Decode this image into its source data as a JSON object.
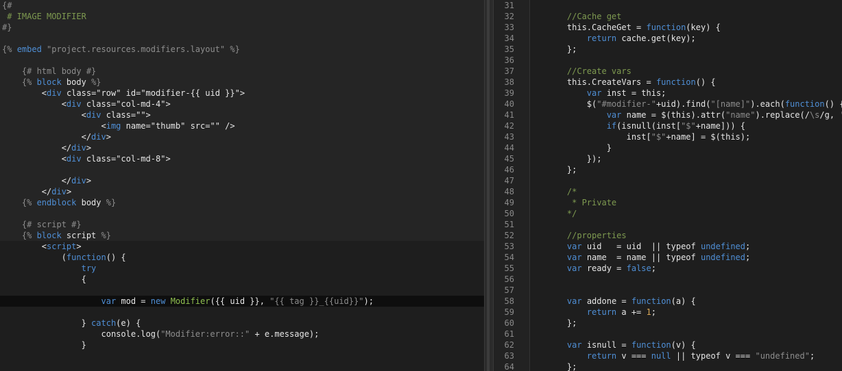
{
  "left_editor": {
    "lines": [
      {
        "hl": true,
        "tokens": [
          [
            "{#",
            "template"
          ]
        ]
      },
      {
        "hl": true,
        "tokens": [
          [
            " # IMAGE MODIFIER",
            "comment"
          ]
        ]
      },
      {
        "hl": true,
        "tokens": [
          [
            "#}",
            "template"
          ]
        ]
      },
      {
        "hl": true,
        "tokens": []
      },
      {
        "hl": true,
        "tokens": [
          [
            "{% ",
            "template"
          ],
          [
            "embed",
            "keyword"
          ],
          [
            " \"project.resources.modifiers.layout\" ",
            "string"
          ],
          [
            "%}",
            "template"
          ]
        ]
      },
      {
        "hl": true,
        "tokens": []
      },
      {
        "hl": true,
        "tokens": [
          [
            "    {# html body #}",
            "template"
          ]
        ]
      },
      {
        "hl": true,
        "tokens": [
          [
            "    {% ",
            "template"
          ],
          [
            "block",
            "keyword"
          ],
          [
            " body ",
            "default"
          ],
          [
            "%}",
            "template"
          ]
        ]
      },
      {
        "hl": true,
        "tokens": [
          [
            "        <",
            "default"
          ],
          [
            "div",
            "tag"
          ],
          [
            " class=",
            "attr"
          ],
          [
            "\"row\"",
            "default"
          ],
          [
            " id=",
            "attr"
          ],
          [
            "\"modifier-{{ uid }}\"",
            "default"
          ],
          [
            ">",
            "default"
          ]
        ]
      },
      {
        "hl": true,
        "tokens": [
          [
            "            <",
            "default"
          ],
          [
            "div",
            "tag"
          ],
          [
            " class=",
            "attr"
          ],
          [
            "\"col-md-4\"",
            "default"
          ],
          [
            ">",
            "default"
          ]
        ]
      },
      {
        "hl": true,
        "tokens": [
          [
            "                <",
            "default"
          ],
          [
            "div",
            "tag"
          ],
          [
            " class=",
            "attr"
          ],
          [
            "\"\"",
            "default"
          ],
          [
            ">",
            "default"
          ]
        ]
      },
      {
        "hl": true,
        "tokens": [
          [
            "                    <",
            "default"
          ],
          [
            "img",
            "tag"
          ],
          [
            " name=",
            "attr"
          ],
          [
            "\"thumb\"",
            "default"
          ],
          [
            " src=",
            "attr"
          ],
          [
            "\"\"",
            "default"
          ],
          [
            " />",
            "default"
          ]
        ]
      },
      {
        "hl": true,
        "tokens": [
          [
            "                </",
            "default"
          ],
          [
            "div",
            "tag"
          ],
          [
            ">",
            "default"
          ]
        ]
      },
      {
        "hl": true,
        "tokens": [
          [
            "            </",
            "default"
          ],
          [
            "div",
            "tag"
          ],
          [
            ">",
            "default"
          ]
        ]
      },
      {
        "hl": true,
        "tokens": [
          [
            "            <",
            "default"
          ],
          [
            "div",
            "tag"
          ],
          [
            " class=",
            "attr"
          ],
          [
            "\"col-md-8\"",
            "default"
          ],
          [
            ">",
            "default"
          ]
        ]
      },
      {
        "hl": true,
        "tokens": []
      },
      {
        "hl": true,
        "tokens": [
          [
            "            </",
            "default"
          ],
          [
            "div",
            "tag"
          ],
          [
            ">",
            "default"
          ]
        ]
      },
      {
        "hl": true,
        "tokens": [
          [
            "        </",
            "default"
          ],
          [
            "div",
            "tag"
          ],
          [
            ">",
            "default"
          ]
        ]
      },
      {
        "hl": true,
        "tokens": [
          [
            "    {% ",
            "template"
          ],
          [
            "endblock",
            "keyword"
          ],
          [
            " body ",
            "default"
          ],
          [
            "%}",
            "template"
          ]
        ]
      },
      {
        "hl": true,
        "tokens": []
      },
      {
        "hl": true,
        "tokens": [
          [
            "    {# script #}",
            "template"
          ]
        ]
      },
      {
        "hl": true,
        "tokens": [
          [
            "    {% ",
            "template"
          ],
          [
            "block",
            "keyword"
          ],
          [
            " script ",
            "default"
          ],
          [
            "%}",
            "template"
          ]
        ]
      },
      {
        "hl": false,
        "tokens": [
          [
            "        <",
            "default"
          ],
          [
            "script",
            "tag"
          ],
          [
            ">",
            "default"
          ]
        ]
      },
      {
        "hl": false,
        "tokens": [
          [
            "            (",
            "default"
          ],
          [
            "function",
            "keyword"
          ],
          [
            "() {",
            "default"
          ]
        ]
      },
      {
        "hl": false,
        "tokens": [
          [
            "                ",
            "default"
          ],
          [
            "try",
            "keyword"
          ]
        ]
      },
      {
        "hl": false,
        "tokens": [
          [
            "                {",
            "default"
          ]
        ]
      },
      {
        "hl": false,
        "tokens": []
      },
      {
        "hl": false,
        "cursor": true,
        "tokens": [
          [
            "                    ",
            "default"
          ],
          [
            "var",
            "keyword"
          ],
          [
            " mod = ",
            "default"
          ],
          [
            "new",
            "keyword"
          ],
          [
            " ",
            "default"
          ],
          [
            "Modifier",
            "fn"
          ],
          [
            "({{ uid }}, ",
            "default"
          ],
          [
            "\"{{ tag }}_{{uid}}\"",
            "string"
          ],
          [
            ");",
            "default"
          ]
        ]
      },
      {
        "hl": false,
        "tokens": []
      },
      {
        "hl": false,
        "tokens": [
          [
            "                } ",
            "default"
          ],
          [
            "catch",
            "keyword"
          ],
          [
            "(e) {",
            "default"
          ]
        ]
      },
      {
        "hl": false,
        "tokens": [
          [
            "                    console.log(",
            "default"
          ],
          [
            "\"Modifier:error::\"",
            "string"
          ],
          [
            " + e.message);",
            "default"
          ]
        ]
      },
      {
        "hl": false,
        "tokens": [
          [
            "                }",
            "default"
          ]
        ]
      },
      {
        "hl": false,
        "tokens": []
      }
    ]
  },
  "right_editor": {
    "lines": [
      {
        "n": "31",
        "tokens": []
      },
      {
        "n": "32",
        "tokens": [
          [
            "    //Cache get",
            "comment"
          ]
        ]
      },
      {
        "n": "33",
        "tokens": [
          [
            "    this.CacheGet = ",
            "default"
          ],
          [
            "function",
            "keyword"
          ],
          [
            "(key) {",
            "default"
          ]
        ]
      },
      {
        "n": "34",
        "tokens": [
          [
            "        ",
            "default"
          ],
          [
            "return",
            "keyword"
          ],
          [
            " cache.get(key);",
            "default"
          ]
        ]
      },
      {
        "n": "35",
        "tokens": [
          [
            "    };",
            "default"
          ]
        ]
      },
      {
        "n": "36",
        "tokens": []
      },
      {
        "n": "37",
        "tokens": [
          [
            "    //Create vars",
            "comment"
          ]
        ]
      },
      {
        "n": "38",
        "tokens": [
          [
            "    this.CreateVars = ",
            "default"
          ],
          [
            "function",
            "keyword"
          ],
          [
            "() {",
            "default"
          ]
        ]
      },
      {
        "n": "39",
        "tokens": [
          [
            "        ",
            "default"
          ],
          [
            "var",
            "keyword"
          ],
          [
            " inst = this;",
            "default"
          ]
        ]
      },
      {
        "n": "40",
        "tokens": [
          [
            "        $(",
            "default"
          ],
          [
            "\"#modifier-\"",
            "string"
          ],
          [
            "+uid).find(",
            "default"
          ],
          [
            "\"[name]\"",
            "string"
          ],
          [
            ").each(",
            "default"
          ],
          [
            "function",
            "keyword"
          ],
          [
            "() {",
            "default"
          ]
        ]
      },
      {
        "n": "41",
        "tokens": [
          [
            "            ",
            "default"
          ],
          [
            "var",
            "keyword"
          ],
          [
            " name = $(this).attr(",
            "default"
          ],
          [
            "\"name\"",
            "string"
          ],
          [
            ").replace(/",
            "default"
          ],
          [
            "\\s",
            "string"
          ],
          [
            "/g, ",
            "default"
          ],
          [
            "''",
            "string"
          ],
          [
            ");",
            "default"
          ]
        ]
      },
      {
        "n": "42",
        "tokens": [
          [
            "            ",
            "default"
          ],
          [
            "if",
            "keyword"
          ],
          [
            "(isnull(inst[",
            "default"
          ],
          [
            "\"$\"",
            "string"
          ],
          [
            "+name])) {",
            "default"
          ]
        ]
      },
      {
        "n": "43",
        "tokens": [
          [
            "                inst[",
            "default"
          ],
          [
            "\"$\"",
            "string"
          ],
          [
            "+name] = $(this);",
            "default"
          ]
        ]
      },
      {
        "n": "44",
        "tokens": [
          [
            "            }",
            "default"
          ]
        ]
      },
      {
        "n": "45",
        "tokens": [
          [
            "        });",
            "default"
          ]
        ]
      },
      {
        "n": "46",
        "tokens": [
          [
            "    };",
            "default"
          ]
        ]
      },
      {
        "n": "47",
        "tokens": []
      },
      {
        "n": "48",
        "tokens": [
          [
            "    /*",
            "comment"
          ]
        ]
      },
      {
        "n": "49",
        "tokens": [
          [
            "     * Private",
            "comment"
          ]
        ]
      },
      {
        "n": "50",
        "tokens": [
          [
            "    */",
            "comment"
          ]
        ]
      },
      {
        "n": "51",
        "tokens": []
      },
      {
        "n": "52",
        "tokens": [
          [
            "    //properties",
            "comment"
          ]
        ]
      },
      {
        "n": "53",
        "tokens": [
          [
            "    ",
            "default"
          ],
          [
            "var",
            "keyword"
          ],
          [
            " uid   = uid  || typeof ",
            "default"
          ],
          [
            "undefined",
            "keyword"
          ],
          [
            ";",
            "default"
          ]
        ]
      },
      {
        "n": "54",
        "tokens": [
          [
            "    ",
            "default"
          ],
          [
            "var",
            "keyword"
          ],
          [
            " name  = name || typeof ",
            "default"
          ],
          [
            "undefined",
            "keyword"
          ],
          [
            ";",
            "default"
          ]
        ]
      },
      {
        "n": "55",
        "tokens": [
          [
            "    ",
            "default"
          ],
          [
            "var",
            "keyword"
          ],
          [
            " ready = ",
            "default"
          ],
          [
            "false",
            "keyword"
          ],
          [
            ";",
            "default"
          ]
        ]
      },
      {
        "n": "56",
        "tokens": []
      },
      {
        "n": "57",
        "tokens": []
      },
      {
        "n": "58",
        "tokens": [
          [
            "    ",
            "default"
          ],
          [
            "var",
            "keyword"
          ],
          [
            " addone = ",
            "default"
          ],
          [
            "function",
            "keyword"
          ],
          [
            "(a) {",
            "default"
          ]
        ]
      },
      {
        "n": "59",
        "tokens": [
          [
            "        ",
            "default"
          ],
          [
            "return",
            "keyword"
          ],
          [
            " a += ",
            "default"
          ],
          [
            "1",
            "number"
          ],
          [
            ";",
            "default"
          ]
        ]
      },
      {
        "n": "60",
        "tokens": [
          [
            "    };",
            "default"
          ]
        ]
      },
      {
        "n": "61",
        "tokens": []
      },
      {
        "n": "62",
        "tokens": [
          [
            "    ",
            "default"
          ],
          [
            "var",
            "keyword"
          ],
          [
            " isnull = ",
            "default"
          ],
          [
            "function",
            "keyword"
          ],
          [
            "(v) {",
            "default"
          ]
        ]
      },
      {
        "n": "63",
        "tokens": [
          [
            "        ",
            "default"
          ],
          [
            "return",
            "keyword"
          ],
          [
            " v === ",
            "default"
          ],
          [
            "null",
            "keyword"
          ],
          [
            " || typeof v === ",
            "default"
          ],
          [
            "\"undefined\"",
            "string"
          ],
          [
            ";",
            "default"
          ]
        ]
      },
      {
        "n": "64",
        "tokens": [
          [
            "    };",
            "default"
          ]
        ]
      }
    ]
  },
  "colors": {
    "background": "#1e1e1e",
    "comment": "#7e9a50",
    "keyword": "#4f8fd6",
    "string": "#8d8d8d",
    "number": "#d8a657",
    "line_number": "#8a8a8a"
  }
}
